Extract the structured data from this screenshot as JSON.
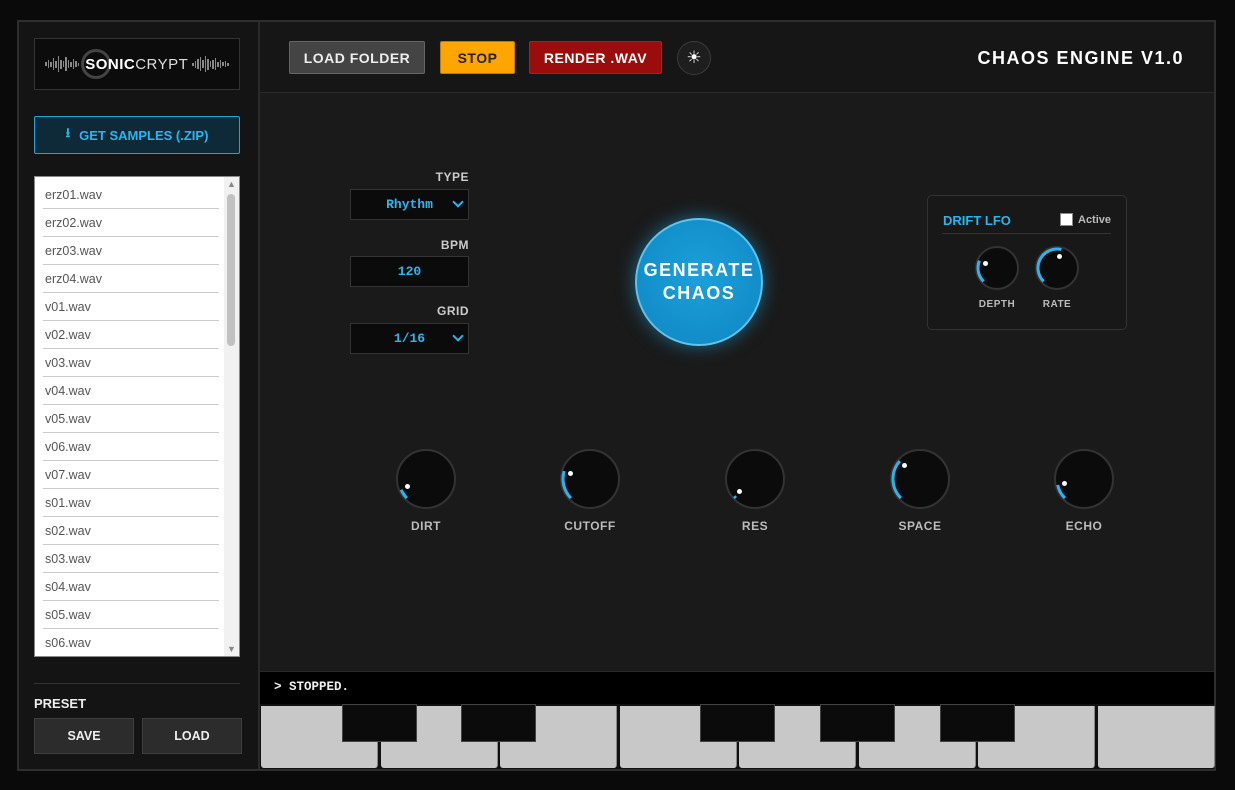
{
  "logo": {
    "sonic": "SONIC",
    "crypt": "CRYPT"
  },
  "sidebar": {
    "get_samples_label": "GET SAMPLES (.ZIP)",
    "files": [
      "erz01.wav",
      "erz02.wav",
      "erz03.wav",
      "erz04.wav",
      "v01.wav",
      "v02.wav",
      "v03.wav",
      "v04.wav",
      "v05.wav",
      "v06.wav",
      "v07.wav",
      "s01.wav",
      "s02.wav",
      "s03.wav",
      "s04.wav",
      "s05.wav",
      "s06.wav"
    ],
    "preset_label": "PRESET",
    "save_label": "SAVE",
    "load_label": "LOAD"
  },
  "header": {
    "load_folder_label": "LOAD FOLDER",
    "stop_label": "STOP",
    "render_label": "RENDER .WAV",
    "theme_icon": "sun-icon",
    "title": "CHAOS ENGINE V1.0"
  },
  "controls": {
    "type_label": "TYPE",
    "type_value": "Rhythm",
    "bpm_label": "BPM",
    "bpm_value": "120",
    "grid_label": "GRID",
    "grid_value": "1/16"
  },
  "generate": {
    "line1": "GENERATE",
    "line2": "CHAOS"
  },
  "lfo": {
    "title": "DRIFT LFO",
    "active_label": "Active",
    "active": false,
    "depth_label": "DEPTH",
    "depth_value": 0.25,
    "rate_label": "RATE",
    "rate_value": 0.55
  },
  "knobs": {
    "dirt": {
      "label": "DIRT",
      "value": 0.08
    },
    "cutoff": {
      "label": "CUTOFF",
      "value": 0.23
    },
    "res": {
      "label": "RES",
      "value": 0.02
    },
    "space": {
      "label": "SPACE",
      "value": 0.32
    },
    "echo": {
      "label": "ECHO",
      "value": 0.12
    }
  },
  "status": {
    "text": "> STOPPED."
  },
  "colors": {
    "accent": "#29b6f0",
    "stop": "#ffa500",
    "render": "#9b0d0d"
  }
}
